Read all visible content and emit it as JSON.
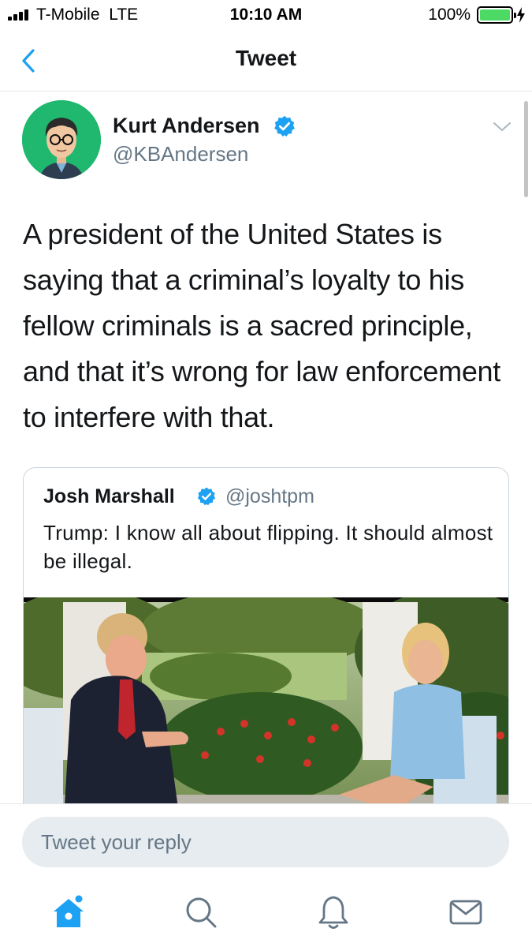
{
  "status_bar": {
    "carrier": "T-Mobile",
    "network": "LTE",
    "time": "10:10 AM",
    "battery": "100%"
  },
  "nav": {
    "title": "Tweet",
    "back_icon": "chevron-left-icon"
  },
  "tweet": {
    "author_name": "Kurt Andersen",
    "author_handle": "@KBAndersen",
    "verified": true,
    "text": "A president of the United States is saying that a criminal’s loyalty to his fellow criminals is a sacred principle, and that it’s wrong for law enforcement to interfere with that."
  },
  "quoted_tweet": {
    "author_name": "Josh Marshall",
    "author_handle": "@joshtpm",
    "verified": true,
    "text": "Trump: I know all about flipping. It should almost be illegal."
  },
  "reply": {
    "placeholder": "Tweet your reply"
  },
  "tab_bar": {
    "items": [
      "home-icon",
      "search-icon",
      "notifications-bell-icon",
      "messages-envelope-icon"
    ],
    "active": "home-icon"
  },
  "colors": {
    "accent": "#1da1f2",
    "battery": "#4cd964",
    "avatar_bg": "#1fb86e"
  }
}
